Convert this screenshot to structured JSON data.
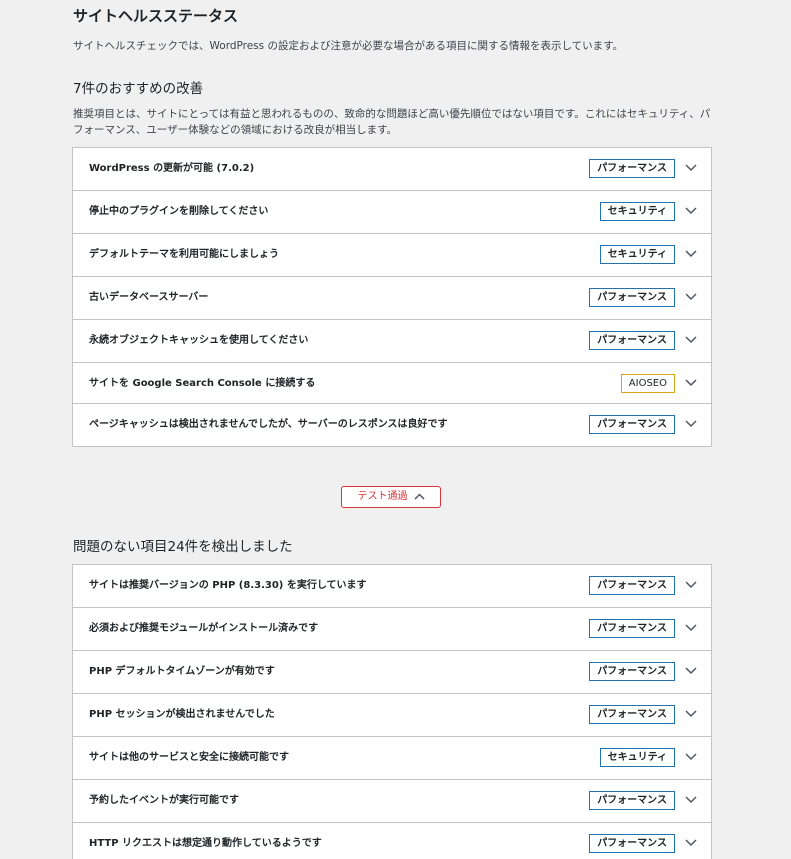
{
  "page": {
    "title": "サイトヘルスステータス",
    "description": "サイトヘルスチェックでは、WordPress の設定および注意が必要な場合がある項目に関する情報を表示しています。"
  },
  "recommended": {
    "heading": "7件のおすすめの改善",
    "description": "推奨項目とは、サイトにとっては有益と思われるものの、致命的な問題ほど高い優先順位ではない項目です。これにはセキュリティ、パフォーマンス、ユーザー体験などの領域における改良が相当します。",
    "items": [
      {
        "label": "WordPress の更新が可能 (7.0.2)",
        "badge": "パフォーマンス",
        "badge_type": "blue"
      },
      {
        "label": "停止中のプラグインを削除してください",
        "badge": "セキュリティ",
        "badge_type": "blue"
      },
      {
        "label": "デフォルトテーマを利用可能にしましょう",
        "badge": "セキュリティ",
        "badge_type": "blue"
      },
      {
        "label": "古いデータベースサーバー",
        "badge": "パフォーマンス",
        "badge_type": "blue"
      },
      {
        "label": "永続オブジェクトキャッシュを使用してください",
        "badge": "パフォーマンス",
        "badge_type": "blue"
      },
      {
        "label": "サイトを Google Search Console に接続する",
        "badge": "AIOSEO",
        "badge_type": "orange"
      },
      {
        "label": "ページキャッシュは検出されませんでしたが、サーバーのレスポンスは良好です",
        "badge": "パフォーマンス",
        "badge_type": "blue"
      }
    ]
  },
  "toggle": {
    "label": "テスト通過"
  },
  "passed": {
    "heading": "問題のない項目24件を検出しました",
    "items": [
      {
        "label": "サイトは推奨バージョンの PHP (8.3.30) を実行しています",
        "badge": "パフォーマンス"
      },
      {
        "label": "必須および推奨モジュールがインストール済みです",
        "badge": "パフォーマンス"
      },
      {
        "label": "PHP デフォルトタイムゾーンが有効です",
        "badge": "パフォーマンス"
      },
      {
        "label": "PHP セッションが検出されませんでした",
        "badge": "パフォーマンス"
      },
      {
        "label": "サイトは他のサービスと安全に接続可能です",
        "badge": "セキュリティ"
      },
      {
        "label": "予約したイベントが実行可能です",
        "badge": "パフォーマンス"
      },
      {
        "label": "HTTP リクエストは想定通り動作しているようです",
        "badge": "パフォーマンス"
      }
    ]
  },
  "colors": {
    "badge_blue": "#2271b1",
    "badge_orange": "#dba617",
    "toggle_red": "#d63638",
    "background": "#f0f0f1"
  }
}
